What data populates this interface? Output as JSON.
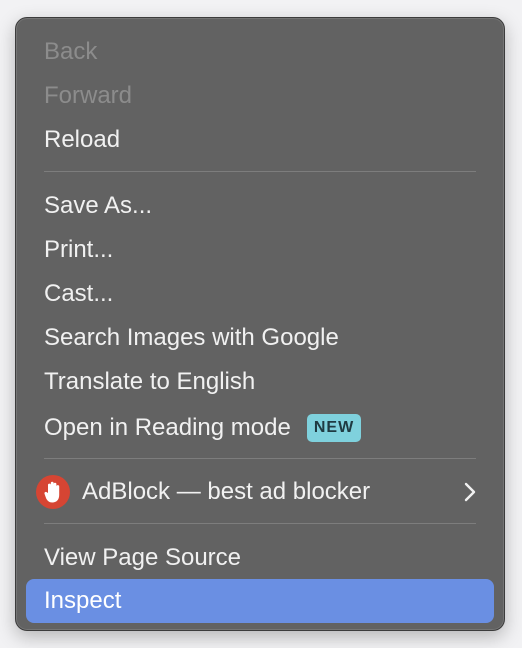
{
  "menu": {
    "back": "Back",
    "forward": "Forward",
    "reload": "Reload",
    "save_as": "Save As...",
    "print": "Print...",
    "cast": "Cast...",
    "search_images": "Search Images with Google",
    "translate": "Translate to English",
    "reading_mode": "Open in Reading mode",
    "reading_mode_badge": "NEW",
    "adblock": "AdBlock — best ad blocker",
    "adblock_icon": "hand-stop-icon",
    "submenu_icon": "chevron-right-icon",
    "view_source": "View Page Source",
    "inspect": "Inspect"
  },
  "colors": {
    "menu_background": "#626262",
    "highlight": "#6a8fe3",
    "badge_background": "#7fd1dd",
    "adblock_red": "#d64533"
  }
}
